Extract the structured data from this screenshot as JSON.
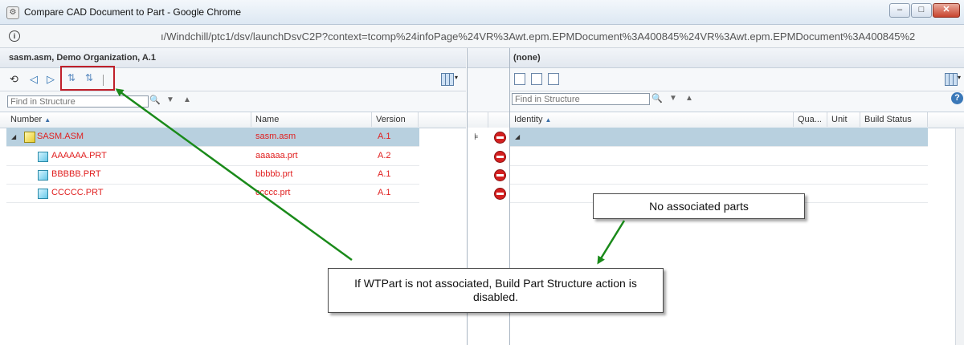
{
  "window": {
    "title": "Compare CAD Document to Part - Google Chrome",
    "minimize": "–",
    "maximize": "□",
    "close": "✕"
  },
  "address": {
    "url": "ı/Windchill/ptc1/dsv/launchDsvC2P?context=tcomp%24infoPage%24VR%3Awt.epm.EPMDocument%3A400845%24VR%3Awt.epm.EPMDocument%3A400845%2"
  },
  "left_pane": {
    "header": "sasm.asm, Demo Organization, A.1",
    "find_placeholder": "Find in Structure",
    "columns": [
      "Number",
      "Name",
      "Version"
    ],
    "rows": [
      {
        "number": "SASM.ASM",
        "name": "sasm.asm",
        "version": "A.1"
      },
      {
        "number": "AAAAAA.PRT",
        "name": "aaaaaa.prt",
        "version": "A.2"
      },
      {
        "number": "BBBBB.PRT",
        "name": "bbbbb.prt",
        "version": "A.1"
      },
      {
        "number": "CCCCC.PRT",
        "name": "ccccc.prt",
        "version": "A.1"
      }
    ]
  },
  "right_pane": {
    "header": "(none)",
    "find_placeholder": "Find in Structure",
    "columns": [
      "Identity",
      "Qua...",
      "Unit",
      "Build Status"
    ]
  },
  "callouts": {
    "no_parts": "No associated parts",
    "disabled_note": "If WTPart is not associated, Build Part Structure action is disabled."
  },
  "colors": {
    "highlight_box": "#c0202a",
    "arrow": "#1a8a1a",
    "selected_row": "#b8d0df",
    "row_text": "#e02020"
  }
}
